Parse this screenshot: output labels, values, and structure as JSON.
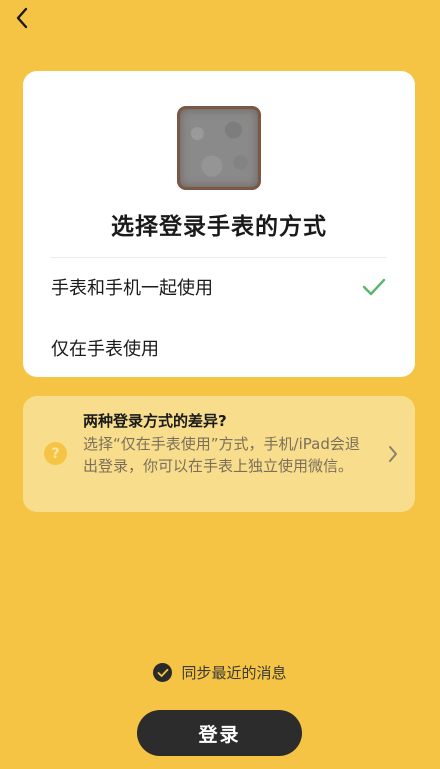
{
  "nav": {
    "back_icon": "chevron-left-icon"
  },
  "card": {
    "title": "选择登录手表的方式",
    "options": [
      {
        "label": "手表和手机一起使用",
        "selected": true
      },
      {
        "label": "仅在手表使用",
        "selected": false
      }
    ],
    "accent_color": "#59B66F"
  },
  "info": {
    "icon": "question-icon",
    "icon_glyph": "?",
    "title": "两种登录方式的差异?",
    "body": "选择“仅在手表使用”方式，手机/iPad会退出登录，你可以在手表上独立使用微信。"
  },
  "sync": {
    "label": "同步最近的消息",
    "checked": true
  },
  "login_button": {
    "label": "登录"
  },
  "colors": {
    "background": "#F6C444",
    "info_background": "#F8DE8C",
    "button": "#2C2C2C"
  }
}
